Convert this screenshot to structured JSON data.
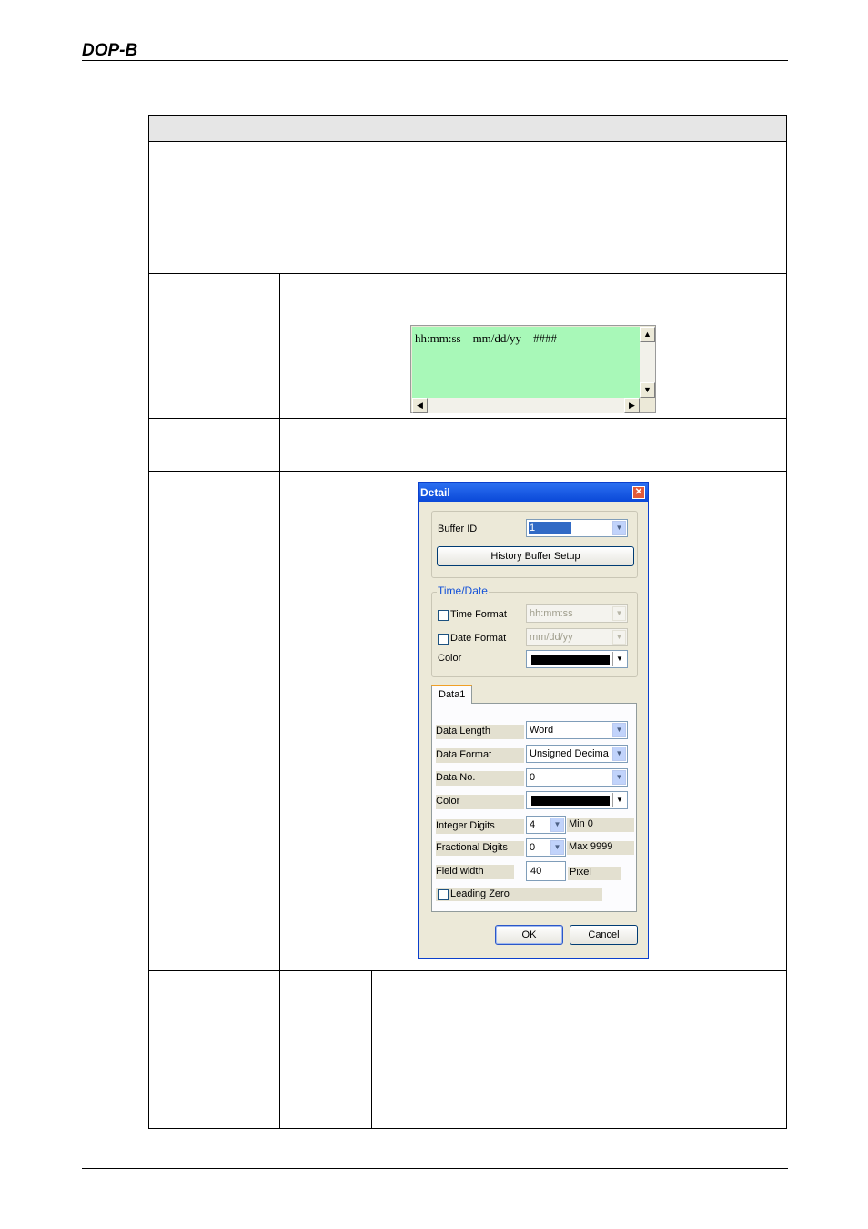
{
  "header": {
    "logo_text": "DOP-B"
  },
  "preview": {
    "text": "hh:mm:ss    mm/dd/yy    ####",
    "scroll_up_icon": "triangle-up-icon",
    "scroll_down_icon": "triangle-down-icon",
    "scroll_left_icon": "triangle-left-icon",
    "scroll_right_icon": "triangle-right-icon"
  },
  "dialog": {
    "title": "Detail",
    "buffer_id_label": "Buffer ID",
    "buffer_id_value": "1",
    "history_button": "History Buffer Setup",
    "time_date": {
      "legend": "Time/Date",
      "time_format_label": "Time Format",
      "time_format_value": "hh:mm:ss",
      "date_format_label": "Date Format",
      "date_format_value": "mm/dd/yy",
      "color_label": "Color"
    },
    "tab": {
      "label": "Data1",
      "data_length_label": "Data Length",
      "data_length_value": "Word",
      "data_format_label": "Data Format",
      "data_format_value": "Unsigned Decima",
      "data_no_label": "Data No.",
      "data_no_value": "0",
      "color_label": "Color",
      "integer_digits_label": "Integer Digits",
      "integer_digits_value": "4",
      "min_text": "Min 0",
      "fractional_digits_label": "Fractional Digits",
      "fractional_digits_value": "0",
      "max_text": "Max 9999",
      "field_width_label": "Field width",
      "field_width_value": "40",
      "pixel_text": "Pixel",
      "leading_zero_label": "Leading Zero"
    },
    "ok_button": "OK",
    "cancel_button": "Cancel"
  },
  "colors": {
    "preview_background": "#a8f8b8",
    "title_bar": "#0a48d8",
    "legend_text": "#1452d8",
    "color_swatch": "#000000"
  }
}
